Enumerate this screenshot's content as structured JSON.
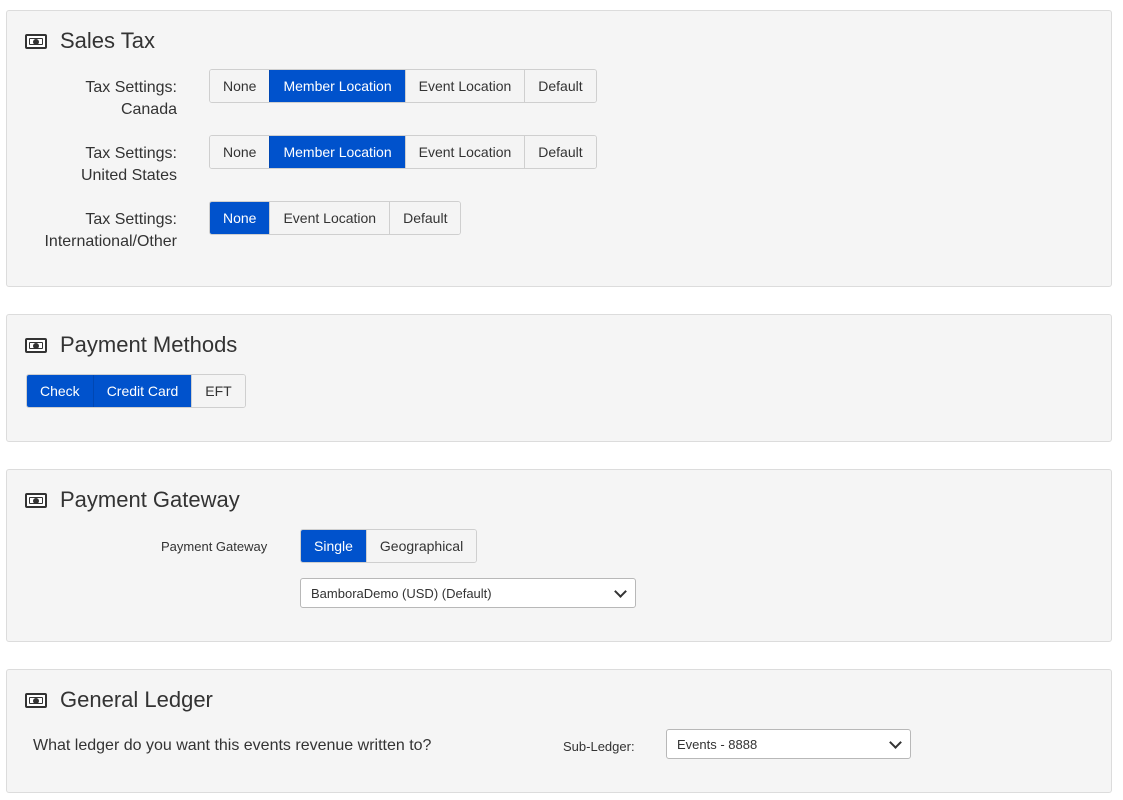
{
  "sales_tax": {
    "title": "Sales Tax",
    "rows": [
      {
        "label_line1": "Tax Settings:",
        "label_line2": "Canada",
        "options": [
          "None",
          "Member Location",
          "Event Location",
          "Default"
        ],
        "selected": "Member Location"
      },
      {
        "label_line1": "Tax Settings:",
        "label_line2": "United States",
        "options": [
          "None",
          "Member Location",
          "Event Location",
          "Default"
        ],
        "selected": "Member Location"
      },
      {
        "label_line1": "Tax Settings:",
        "label_line2": "International/Other",
        "options": [
          "None",
          "Event Location",
          "Default"
        ],
        "selected": "None"
      }
    ]
  },
  "payment_methods": {
    "title": "Payment Methods",
    "options": [
      "Check",
      "Credit Card",
      "EFT"
    ],
    "selected": [
      "Check",
      "Credit Card"
    ]
  },
  "payment_gateway": {
    "title": "Payment Gateway",
    "label": "Payment Gateway",
    "options": [
      "Single",
      "Geographical"
    ],
    "selected": "Single",
    "gateway_select_value": "BamboraDemo (USD) (Default)"
  },
  "general_ledger": {
    "title": "General Ledger",
    "question": "What ledger do you want this events revenue written to?",
    "sub_ledger_label": "Sub-Ledger:",
    "sub_ledger_value": "Events - 8888"
  },
  "colors": {
    "accent": "#0052cc",
    "panel_bg": "#f5f5f5",
    "border": "#dcdcdc"
  },
  "icons": {
    "section_icon": "money-bill-icon"
  }
}
